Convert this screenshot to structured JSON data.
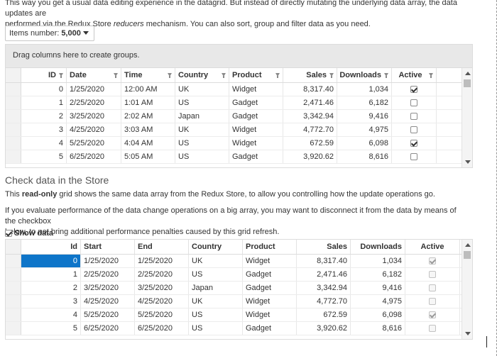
{
  "intro": {
    "line1": "This way you get a usual data editing experience in the datagrid. But instead of directly mutating the underlying data array, the data updates are",
    "line2_a": "performed via the Redux Store ",
    "line2_em": "reducers",
    "line2_b": " mechanism. You can also sort, group and filter data as you need."
  },
  "items_select": {
    "label": "Items number:",
    "value": "5,000"
  },
  "grid1": {
    "group_panel": "Drag columns here to create groups.",
    "columns": [
      "ID",
      "Date",
      "Time",
      "Country",
      "Product",
      "Sales",
      "Downloads",
      "Active"
    ],
    "rows": [
      {
        "id": "0",
        "date": "1/25/2020",
        "time": "12:00 AM",
        "country": "UK",
        "product": "Widget",
        "sales": "8,317.40",
        "downloads": "1,034",
        "active": true
      },
      {
        "id": "1",
        "date": "2/25/2020",
        "time": "1:01 AM",
        "country": "US",
        "product": "Gadget",
        "sales": "2,471.46",
        "downloads": "6,182",
        "active": false
      },
      {
        "id": "2",
        "date": "3/25/2020",
        "time": "2:02 AM",
        "country": "Japan",
        "product": "Gadget",
        "sales": "3,342.94",
        "downloads": "9,416",
        "active": false
      },
      {
        "id": "3",
        "date": "4/25/2020",
        "time": "3:03 AM",
        "country": "UK",
        "product": "Widget",
        "sales": "4,772.70",
        "downloads": "4,975",
        "active": false
      },
      {
        "id": "4",
        "date": "5/25/2020",
        "time": "4:04 AM",
        "country": "US",
        "product": "Widget",
        "sales": "672.59",
        "downloads": "6,098",
        "active": true
      },
      {
        "id": "5",
        "date": "6/25/2020",
        "time": "5:05 AM",
        "country": "US",
        "product": "Gadget",
        "sales": "3,920.62",
        "downloads": "8,616",
        "active": false
      }
    ]
  },
  "section": {
    "title": "Check data in the Store",
    "p1_a": "This ",
    "p1_b": "read-only",
    "p1_c": " grid shows the same data array from the Redux Store, to allow you controlling how the update operations go.",
    "p2_line1": "If you evaluate performance of the data change operations on a big array, you may want to disconnect it from the data by means of the checkbox",
    "p2_line2": "below, to not bring additional performance penalties caused by this grid refresh.",
    "show_data": "Show data"
  },
  "grid2": {
    "columns": [
      "Id",
      "Start",
      "End",
      "Country",
      "Product",
      "Sales",
      "Downloads",
      "Active"
    ],
    "rows": [
      {
        "id": "0",
        "start": "1/25/2020",
        "end": "1/25/2020",
        "country": "UK",
        "product": "Widget",
        "sales": "8,317.40",
        "downloads": "1,034",
        "active": true
      },
      {
        "id": "1",
        "start": "2/25/2020",
        "end": "2/25/2020",
        "country": "US",
        "product": "Gadget",
        "sales": "2,471.46",
        "downloads": "6,182",
        "active": false
      },
      {
        "id": "2",
        "start": "3/25/2020",
        "end": "3/25/2020",
        "country": "Japan",
        "product": "Gadget",
        "sales": "3,342.94",
        "downloads": "9,416",
        "active": false
      },
      {
        "id": "3",
        "start": "4/25/2020",
        "end": "4/25/2020",
        "country": "UK",
        "product": "Widget",
        "sales": "4,772.70",
        "downloads": "4,975",
        "active": false
      },
      {
        "id": "4",
        "start": "5/25/2020",
        "end": "5/25/2020",
        "country": "US",
        "product": "Widget",
        "sales": "672.59",
        "downloads": "6,098",
        "active": true
      },
      {
        "id": "5",
        "start": "6/25/2020",
        "end": "6/25/2020",
        "country": "US",
        "product": "Gadget",
        "sales": "3,920.62",
        "downloads": "8,616",
        "active": false
      }
    ]
  },
  "colors": {
    "selection": "#0e75c9",
    "group_panel": "#e8e8e8"
  }
}
